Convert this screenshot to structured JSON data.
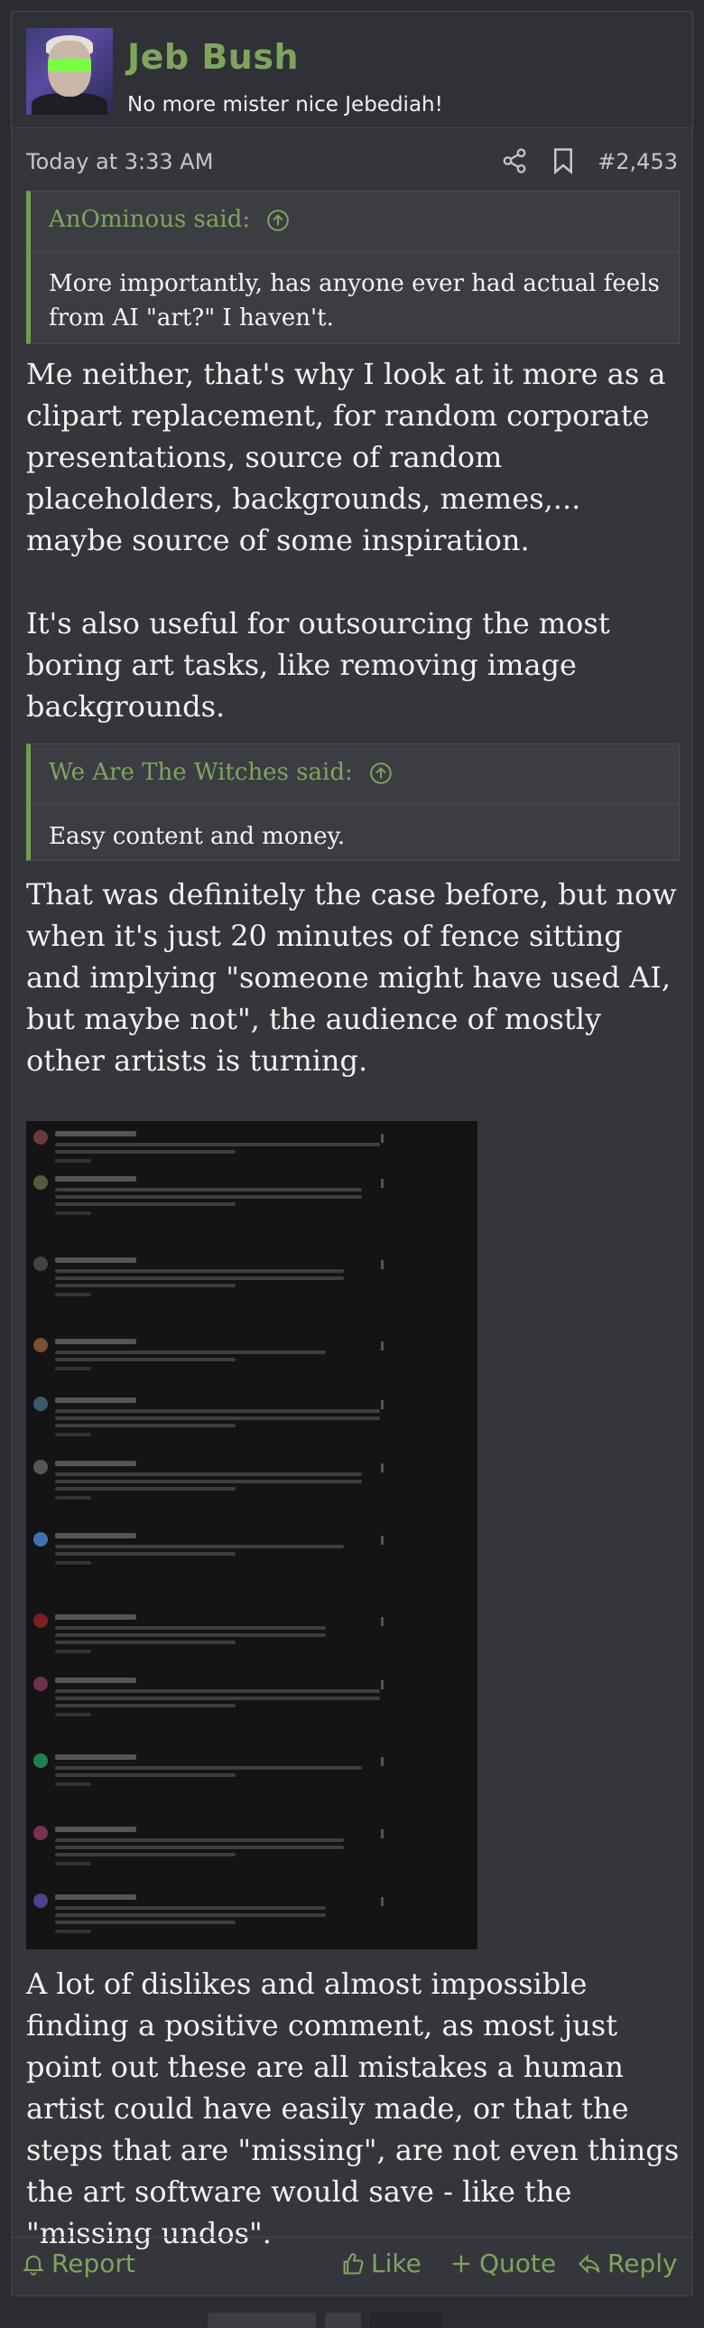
{
  "user": {
    "name": "Jeb Bush",
    "title": "No more mister nice Jebediah!"
  },
  "meta": {
    "timestamp": "Today at 3:33 AM",
    "post_number": "#2,453"
  },
  "quote1": {
    "author": "AnOminous said:",
    "text": "More importantly, has anyone ever had actual feels from AI \"art?\" I haven't."
  },
  "para1": "Me neither, that's why I look at it more as a clipart replacement, for random corporate presentations, source of random placeholders, backgrounds, memes,... maybe source of some inspiration.",
  "para2": "It's also useful for outsourcing the most boring art tasks, like removing image backgrounds.",
  "quote2": {
    "author": "We Are The Witches said:",
    "text": "Easy content and money."
  },
  "para3": "That was definitely the case before, but now when it's just 20 minutes of fence sitting and implying \"someone might have used AI, but maybe not\", the audience of mostly other artists is turning.",
  "para4": "A lot of dislikes and almost impossible finding a positive comment, as most just point out these are all mistakes a human artist could have easily made, or that the steps that are \"missing\", are not even things the art software would save - like the \"missing undos\".",
  "actions": {
    "report": "Report",
    "like": "Like",
    "quote": "Quote",
    "reply": "Reply"
  },
  "colors": {
    "accent": "#7fa55d",
    "background": "#2b2c30",
    "post_bg": "#35363b"
  }
}
